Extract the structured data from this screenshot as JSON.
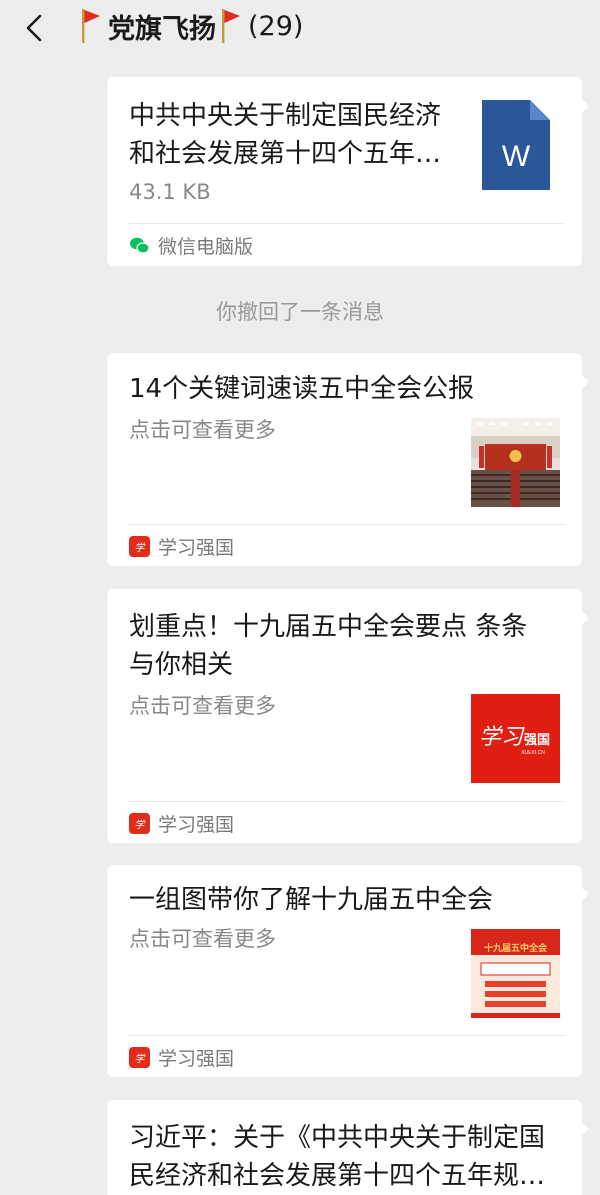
{
  "header": {
    "title": "党旗飞扬",
    "count": "(29)"
  },
  "messages": [
    {
      "type": "file",
      "title": "中共中央关于制定国民经济和社会发展第十四个五年规划和二〇三五年远景目标的建议",
      "size": "43.1 KB",
      "source": "微信电脑版",
      "file_type_letter": "W"
    },
    {
      "type": "system",
      "text": "你撤回了一条消息"
    },
    {
      "type": "link",
      "title": "14个关键词速读五中全会公报",
      "subtitle": "点击可查看更多",
      "source": "学习强国"
    },
    {
      "type": "link",
      "title": "划重点！十九届五中全会要点 条条与你相关",
      "subtitle": "点击可查看更多",
      "source": "学习强国",
      "thumb_text": "学习强国",
      "thumb_sub": "XUEXI.CN"
    },
    {
      "type": "link",
      "title": "一组图带你了解十九届五中全会",
      "subtitle": "点击可查看更多",
      "source": "学习强国",
      "thumb_text": "十九届五中全会"
    },
    {
      "type": "link",
      "title": "习近平：关于《中共中央关于制定国民经济和社会发展第十四个五年规划和二〇三五年远景目标的建议》的说明"
    }
  ],
  "colors": {
    "background": "#ededed",
    "card": "#ffffff",
    "word_blue": "#2b579a",
    "xuexi_red": "#e32b1c",
    "wechat_green": "#07c160"
  },
  "icons": {
    "back": "chevron-left-icon",
    "flag": "red-flag-icon",
    "file": "word-file-icon",
    "wechat": "wechat-icon",
    "xuexi": "xuexi-qiangguo-icon"
  }
}
